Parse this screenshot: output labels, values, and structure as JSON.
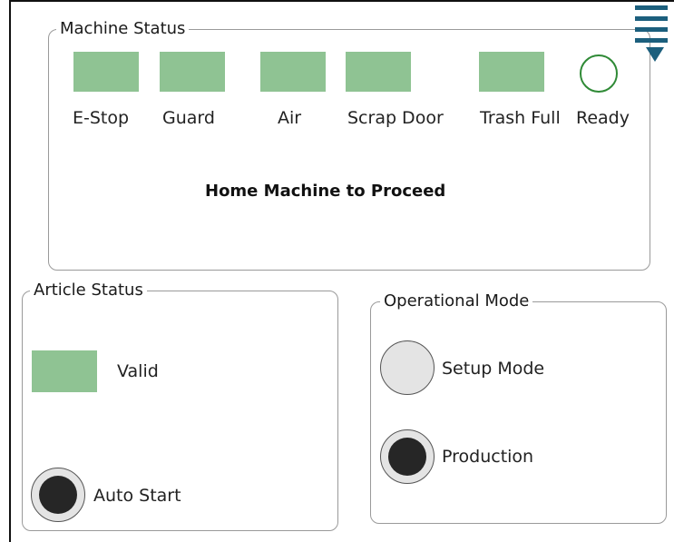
{
  "machine_status": {
    "title": "Machine Status",
    "indicators": [
      {
        "label": "E-Stop",
        "color": "#8fc393"
      },
      {
        "label": "Guard",
        "color": "#8fc393"
      },
      {
        "label": "Air",
        "color": "#8fc393"
      },
      {
        "label": "Scrap Door",
        "color": "#8fc393"
      },
      {
        "label": "Trash Full",
        "color": "#8fc393"
      }
    ],
    "ready": {
      "label": "Ready",
      "color": "#2f8a36"
    },
    "message": "Home Machine to Proceed"
  },
  "article_status": {
    "title": "Article Status",
    "valid_label": "Valid",
    "auto_start_label": "Auto Start"
  },
  "operational_mode": {
    "title": "Operational Mode",
    "options": [
      {
        "label": "Setup Mode",
        "selected": false
      },
      {
        "label": "Production",
        "selected": true
      }
    ]
  },
  "menu": {
    "icon": "menu-icon",
    "color": "#1c5f7d"
  }
}
